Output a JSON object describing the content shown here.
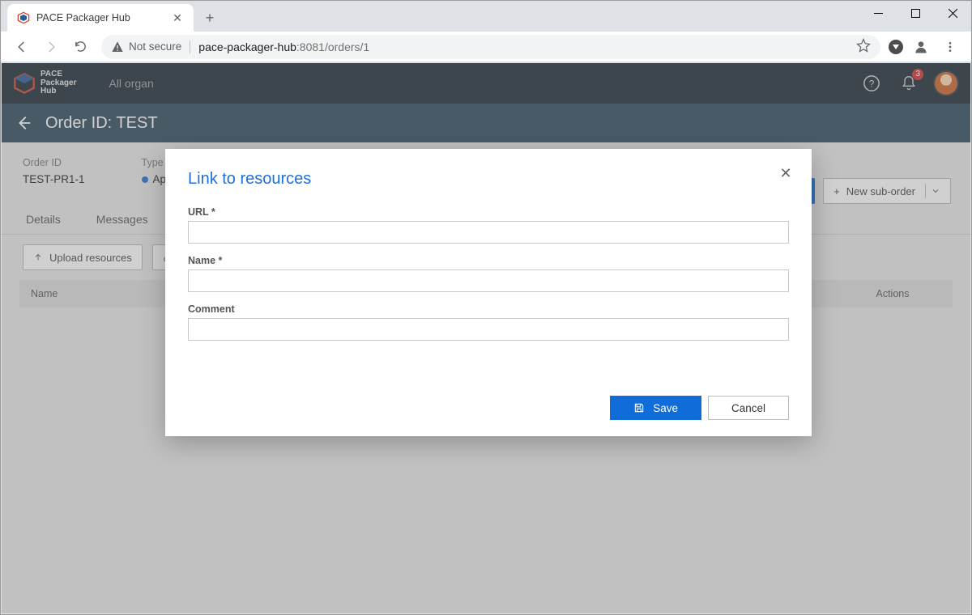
{
  "browser": {
    "tab_title": "PACE Packager Hub",
    "not_secure": "Not secure",
    "url_host": "pace-packager-hub",
    "url_path": ":8081/orders/1"
  },
  "app_header": {
    "brand_line1": "PACE",
    "brand_line2": "Packager",
    "brand_line3": "Hub",
    "org_label": "All organ",
    "notification_count": "3"
  },
  "order_bar": {
    "title": "Order ID: TEST"
  },
  "order_meta": {
    "id_label": "Order ID",
    "id_value": "TEST-PR1-1",
    "type_label": "Type",
    "type_value": "App Packag"
  },
  "tabs": {
    "details": "Details",
    "messages": "Messages"
  },
  "toolbar": {
    "upload": "Upload resources",
    "new_sub_order": "New sub-order"
  },
  "table": {
    "col_name": "Name",
    "col_actions": "Actions"
  },
  "modal": {
    "title": "Link to resources",
    "url_label": "URL *",
    "name_label": "Name *",
    "comment_label": "Comment",
    "save": "Save",
    "cancel": "Cancel"
  }
}
